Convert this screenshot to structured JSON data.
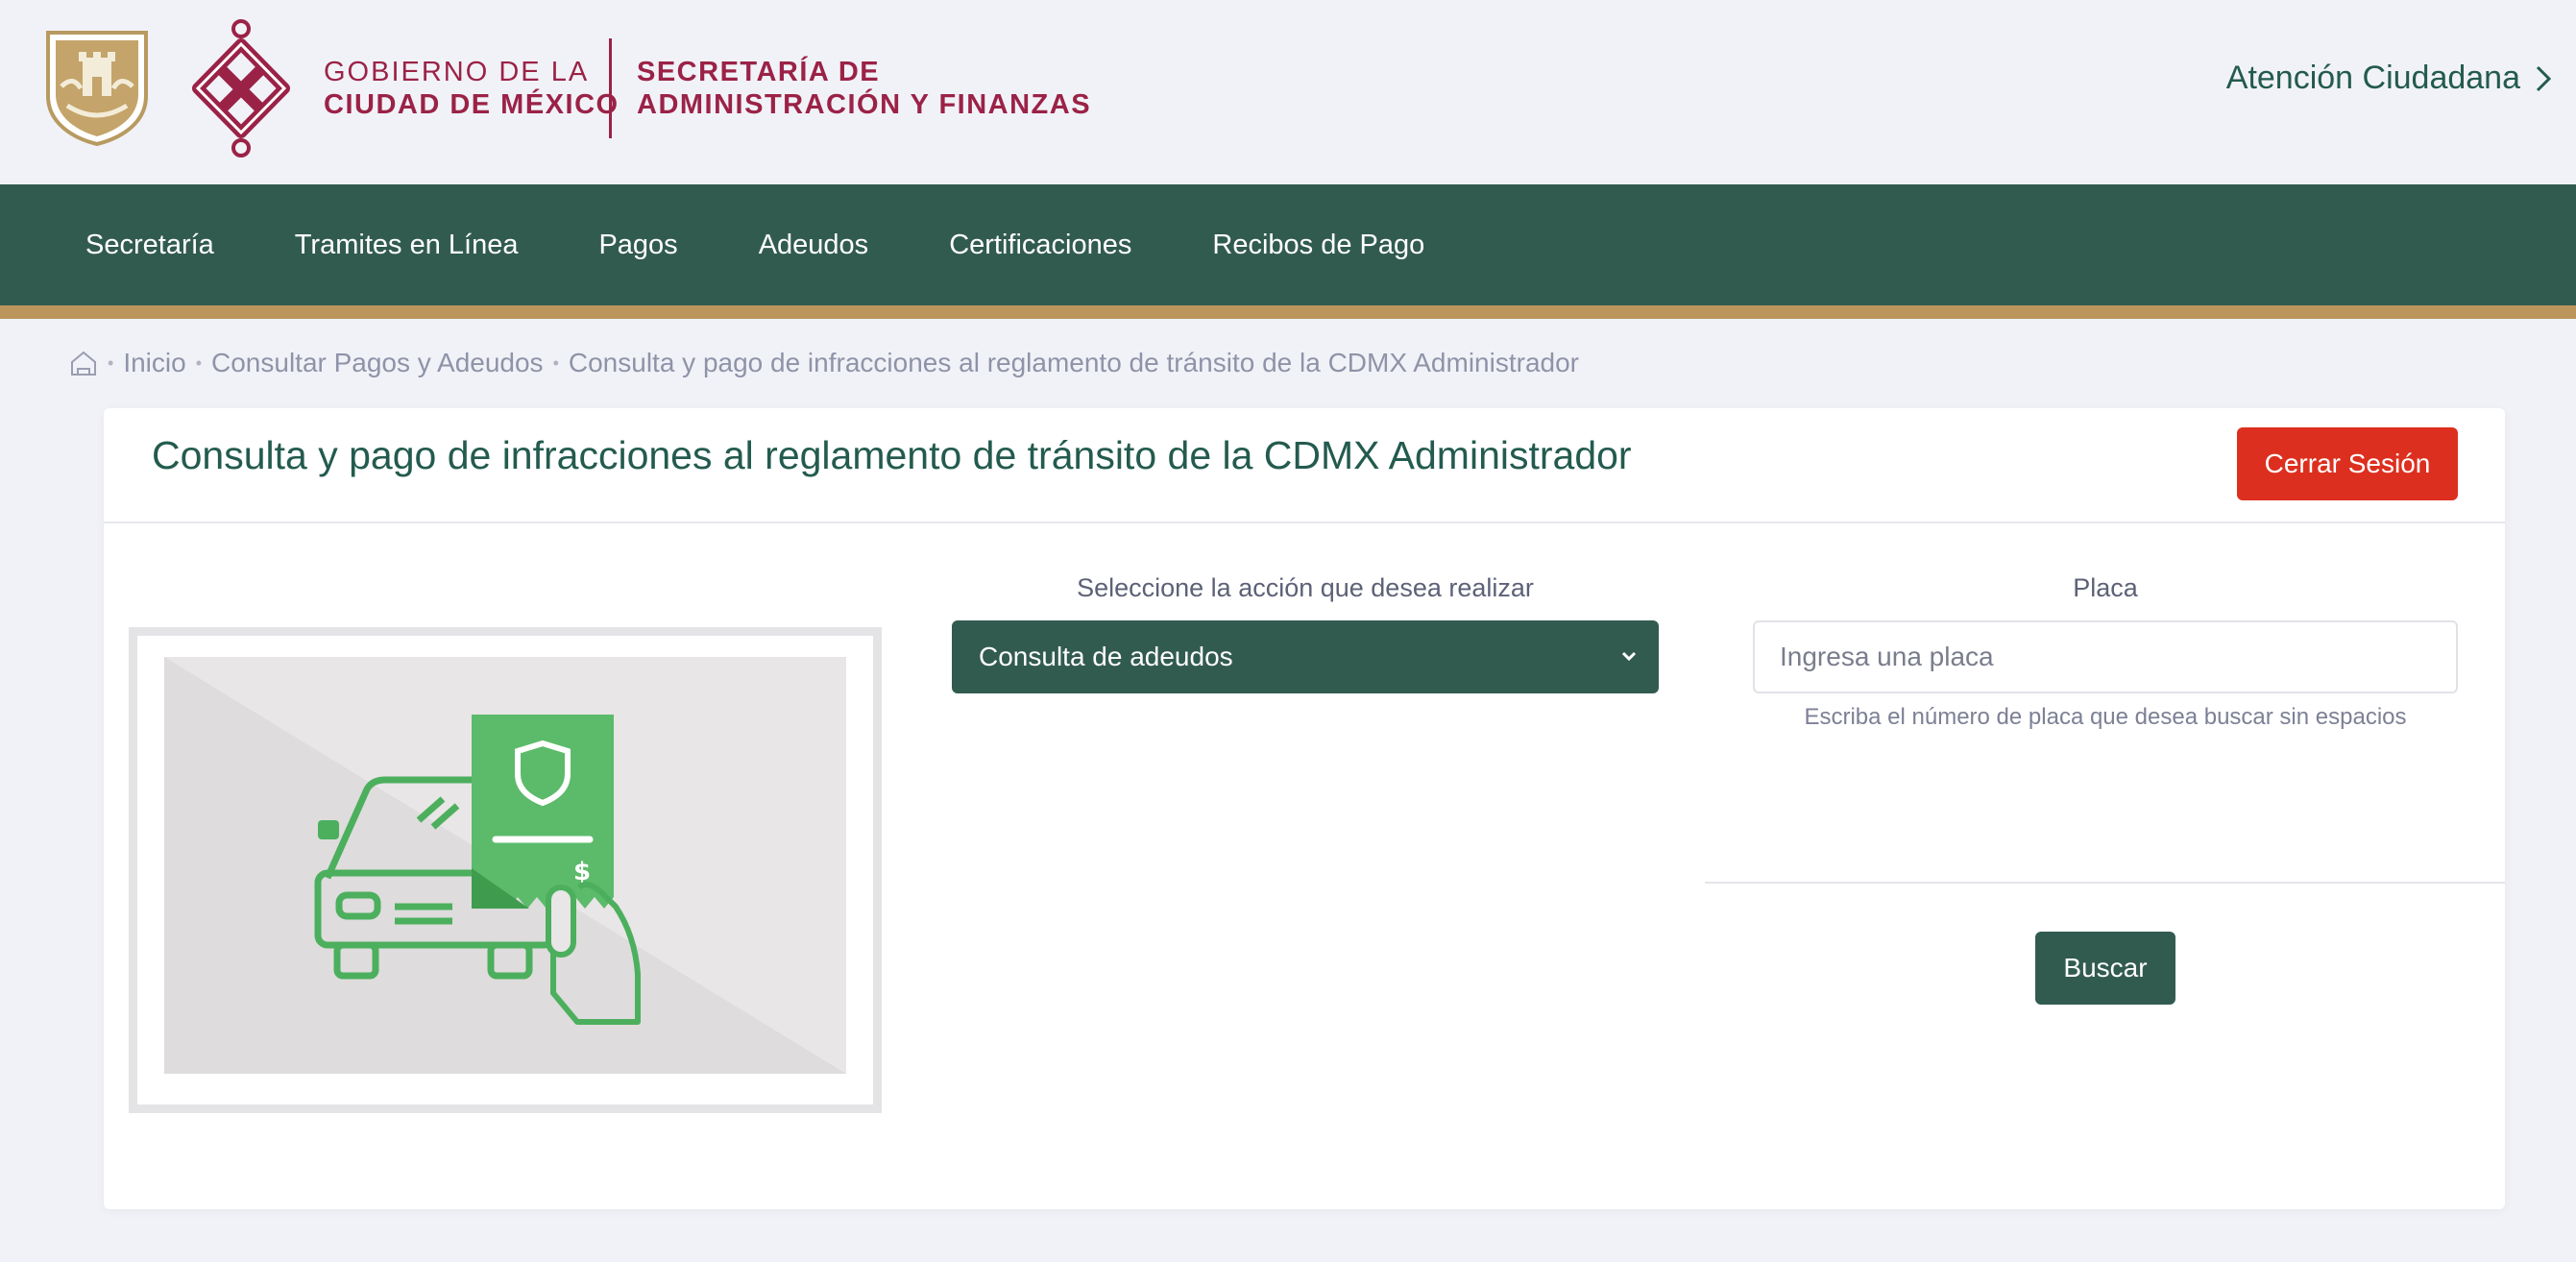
{
  "header": {
    "gov_line1": "GOBIERNO DE LA",
    "gov_line2": "CIUDAD DE MÉXICO",
    "sec_line1": "SECRETARÍA DE",
    "sec_line2": "ADMINISTRACIÓN Y FINANZAS",
    "atencion": "Atención Ciudadana",
    "brand_color": "#9b2247"
  },
  "nav": {
    "items": [
      "Secretaría",
      "Tramites en Línea",
      "Pagos",
      "Adeudos",
      "Certificaciones",
      "Recibos de Pago"
    ],
    "bg_color": "#325b50",
    "accent_color": "#bc955c"
  },
  "breadcrumb": {
    "home_icon": "home-icon",
    "items": [
      "Inicio",
      "Consultar Pagos y Adeudos",
      "Consulta y pago de infracciones al reglamento de tránsito de la CDMX Administrador"
    ]
  },
  "page": {
    "title": "Consulta y pago de infracciones al reglamento de tránsito de la CDMX Administrador",
    "logout_label": "Cerrar Sesión",
    "action_label": "Seleccione la acción que desea realizar",
    "action_selected": "Consulta de adeudos",
    "placa_label": "Placa",
    "placa_placeholder": "Ingresa una placa",
    "placa_help": "Escriba el número de placa que desea buscar sin espacios",
    "search_label": "Buscar",
    "danger_color": "#dd2f1f"
  }
}
